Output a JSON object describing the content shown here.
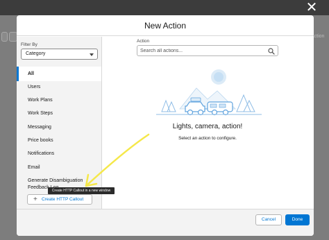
{
  "background": {
    "partial_label": "Action"
  },
  "modal": {
    "title": "New Action",
    "filter": {
      "label": "Filter By",
      "selected": "Category"
    },
    "categories": [
      {
        "label": "All",
        "active": true
      },
      {
        "label": "Users"
      },
      {
        "label": "Work Plans"
      },
      {
        "label": "Work Steps"
      },
      {
        "label": "Messaging"
      },
      {
        "label": "Price books"
      },
      {
        "label": "Notifications"
      },
      {
        "label": "Email"
      },
      {
        "label": "Generate Disambiguation"
      },
      {
        "label": "Feedback Log"
      }
    ],
    "create_button": "Create HTTP Callout",
    "tooltip": "Create HTTP Callout in a new window",
    "action": {
      "label": "Action",
      "search_placeholder": "Search all actions..."
    },
    "empty_state": {
      "title": "Lights, camera, action!",
      "subtitle": "Select an action to configure."
    },
    "footer": {
      "cancel": "Cancel",
      "done": "Done"
    }
  },
  "colors": {
    "brand": "#0176d3",
    "annotation_arrow": "#f5e84a"
  }
}
